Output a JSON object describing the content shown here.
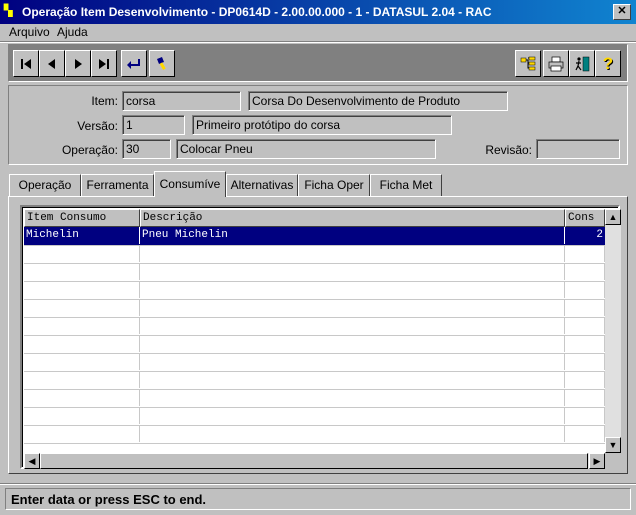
{
  "window": {
    "title": "Operação Item Desenvolvimento - DP0614D - 2.00.00.000 - 1 - DATASUL 2.04 - RAC"
  },
  "menu": {
    "arquivo": "Arquivo",
    "ajuda": "Ajuda"
  },
  "header": {
    "item_label": "Item:",
    "item_code": "corsa",
    "item_desc": "Corsa Do Desenvolvimento de Produto",
    "versao_label": "Versão:",
    "versao_value": "1",
    "versao_desc": "Primeiro protótipo do corsa",
    "operacao_label": "Operação:",
    "operacao_value": "30",
    "operacao_desc": "Colocar Pneu",
    "revisao_label": "Revisão:",
    "revisao_value": ""
  },
  "tabs": [
    "Operação",
    "Ferramenta",
    "Consumíve",
    "Alternativas",
    "Ficha Oper",
    "Ficha Met"
  ],
  "grid": {
    "columns": [
      "Item Consumo",
      "Descrição",
      "Cons"
    ],
    "rows": [
      {
        "item": "Michelin",
        "descricao": "Pneu Michelin",
        "cons": "2"
      }
    ]
  },
  "status": {
    "text": "Enter data or press ESC to end."
  }
}
